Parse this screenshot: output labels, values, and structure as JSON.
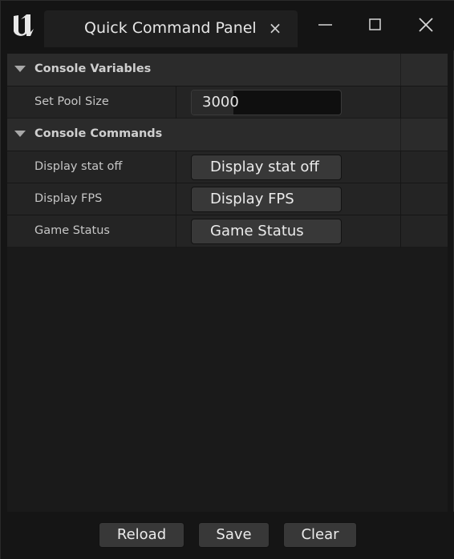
{
  "window": {
    "tab_title": "Quick Command Panel",
    "tab_close_glyph": "×",
    "logo_icon": "unreal-engine-logo-icon",
    "controls": [
      "minimize-icon",
      "maximize-icon",
      "close-icon"
    ]
  },
  "categories": [
    {
      "label": "Console Variables",
      "rows": [
        {
          "name": "Set Pool Size",
          "type": "number-input",
          "value": "3000"
        }
      ]
    },
    {
      "label": "Console Commands",
      "rows": [
        {
          "name": "Display stat off",
          "type": "button",
          "button_label": "Display stat off"
        },
        {
          "name": "Display FPS",
          "type": "button",
          "button_label": "Display FPS"
        },
        {
          "name": "Game Status",
          "type": "button",
          "button_label": "Game Status"
        }
      ]
    }
  ],
  "footer": {
    "reload_label": "Reload",
    "save_label": "Save",
    "clear_label": "Clear"
  },
  "colors": {
    "background": "#151515",
    "panel": "#1a1a1a",
    "category_header": "#2b2b2b",
    "row": "#242424",
    "button": "#383838",
    "text": "#c6c6c6"
  }
}
